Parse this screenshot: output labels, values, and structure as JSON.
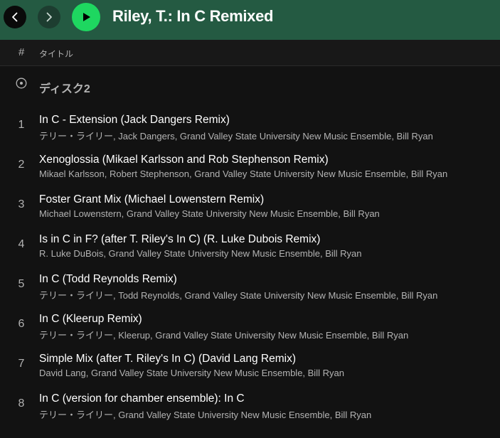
{
  "header": {
    "back_icon": "chevron-left-icon",
    "forward_icon": "chevron-right-icon",
    "play_icon": "play-icon",
    "album_title": "Riley, T.: In C Remixed",
    "accent": "#1ed760",
    "background": "#245a42"
  },
  "columns": {
    "number": "#",
    "title": "タイトル"
  },
  "disc": {
    "icon": "disc-icon",
    "label": "ディスク2"
  },
  "tracks": [
    {
      "num": "1",
      "title": "In C - Extension (Jack Dangers Remix)",
      "artists": "テリー・ライリー, Jack Dangers, Grand Valley State University New Music Ensemble, Bill Ryan"
    },
    {
      "num": "2",
      "title": "Xenoglossia (Mikael Karlsson and Rob Stephenson Remix)",
      "artists": "Mikael Karlsson, Robert Stephenson, Grand Valley State University New Music Ensemble, Bill Ryan"
    },
    {
      "num": "3",
      "title": "Foster Grant Mix (Michael Lowenstern Remix)",
      "artists": "Michael Lowenstern, Grand Valley State University New Music Ensemble, Bill Ryan"
    },
    {
      "num": "4",
      "title": "Is in C in F? (after T. Riley's In C) (R. Luke Dubois Remix)",
      "artists": "R. Luke DuBois, Grand Valley State University New Music Ensemble, Bill Ryan"
    },
    {
      "num": "5",
      "title": "In C (Todd Reynolds Remix)",
      "artists": "テリー・ライリー, Todd Reynolds, Grand Valley State University New Music Ensemble, Bill Ryan"
    },
    {
      "num": "6",
      "title": "In C (Kleerup Remix)",
      "artists": "テリー・ライリー, Kleerup, Grand Valley State University New Music Ensemble, Bill Ryan"
    },
    {
      "num": "7",
      "title": "Simple Mix (after T. Riley's In C) (David Lang Remix)",
      "artists": "David Lang, Grand Valley State University New Music Ensemble, Bill Ryan"
    },
    {
      "num": "8",
      "title": "In C (version for chamber ensemble): In C",
      "artists": "テリー・ライリー, Grand Valley State University New Music Ensemble, Bill Ryan"
    }
  ]
}
